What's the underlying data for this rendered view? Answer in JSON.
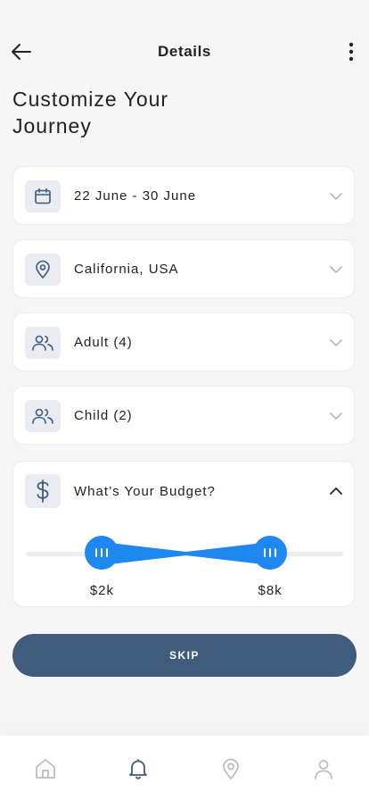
{
  "header": {
    "title": "Details"
  },
  "page": {
    "title": "Customize Your Journey"
  },
  "options": [
    {
      "label": "22 June - 30 June",
      "icon": "calendar-icon"
    },
    {
      "label": "California, USA",
      "icon": "location-pin-icon"
    },
    {
      "label": "Adult (4)",
      "icon": "users-icon"
    },
    {
      "label": "Child (2)",
      "icon": "users-icon"
    }
  ],
  "budget": {
    "label": "What’s Your Budget?",
    "icon": "dollar-icon",
    "min_label": "$2k",
    "max_label": "$8k",
    "min_fraction": 0.24,
    "max_fraction": 0.77
  },
  "skip_label": "SKIP",
  "colors": {
    "accent": "#1e88f0",
    "primary_button": "#3f5c7c",
    "icon_stroke": "#3f5c7c",
    "active_tab": "#3f5c7c",
    "inactive_tab": "#b5bcc6"
  },
  "tabs": [
    {
      "icon": "home-icon",
      "active": false
    },
    {
      "icon": "bell-icon",
      "active": true
    },
    {
      "icon": "location-pin-icon",
      "active": false
    },
    {
      "icon": "user-icon",
      "active": false
    }
  ]
}
